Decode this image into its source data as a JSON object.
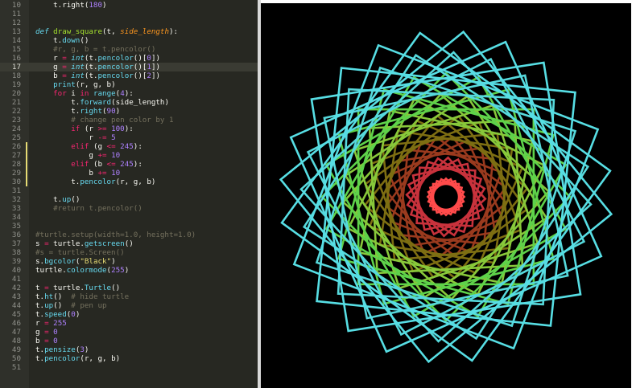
{
  "editor": {
    "lines": [
      {
        "n": "10",
        "t": [
          {
            "c": "    t.right(",
            "s": ""
          },
          {
            "c": "180",
            "s": "num"
          },
          {
            "c": ")",
            "s": ""
          }
        ]
      },
      {
        "n": "11",
        "t": []
      },
      {
        "n": "12",
        "t": []
      },
      {
        "n": "13",
        "t": [
          {
            "c": "def ",
            "s": "it"
          },
          {
            "c": "draw_square",
            "s": "fn"
          },
          {
            "c": "(t, ",
            "s": ""
          },
          {
            "c": "side_length",
            "s": "par"
          },
          {
            "c": "):",
            "s": ""
          }
        ]
      },
      {
        "n": "14",
        "t": [
          {
            "c": "    t.",
            "s": ""
          },
          {
            "c": "down",
            "s": "bi"
          },
          {
            "c": "()",
            "s": ""
          }
        ]
      },
      {
        "n": "15",
        "t": [
          {
            "c": "    #r, g, b = t.pencolor()",
            "s": "cm"
          }
        ]
      },
      {
        "n": "16",
        "t": [
          {
            "c": "    r ",
            "s": ""
          },
          {
            "c": "=",
            "s": "kw"
          },
          {
            "c": " ",
            "s": ""
          },
          {
            "c": "int",
            "s": "it"
          },
          {
            "c": "(t.",
            "s": ""
          },
          {
            "c": "pencolor",
            "s": "bi"
          },
          {
            "c": "()[",
            "s": ""
          },
          {
            "c": "0",
            "s": "num"
          },
          {
            "c": "])",
            "s": ""
          }
        ]
      },
      {
        "n": "17",
        "t": [
          {
            "c": "    g ",
            "s": ""
          },
          {
            "c": "=",
            "s": "kw"
          },
          {
            "c": " ",
            "s": ""
          },
          {
            "c": "int",
            "s": "it"
          },
          {
            "c": "(t.",
            "s": ""
          },
          {
            "c": "pencolor",
            "s": "bi"
          },
          {
            "c": "()[",
            "s": ""
          },
          {
            "c": "1",
            "s": "num"
          },
          {
            "c": "])",
            "s": ""
          }
        ],
        "active": true
      },
      {
        "n": "18",
        "t": [
          {
            "c": "    b ",
            "s": ""
          },
          {
            "c": "=",
            "s": "kw"
          },
          {
            "c": " ",
            "s": ""
          },
          {
            "c": "int",
            "s": "it"
          },
          {
            "c": "(t.",
            "s": ""
          },
          {
            "c": "pencolor",
            "s": "bi"
          },
          {
            "c": "()[",
            "s": ""
          },
          {
            "c": "2",
            "s": "num"
          },
          {
            "c": "])",
            "s": ""
          }
        ]
      },
      {
        "n": "19",
        "t": [
          {
            "c": "    ",
            "s": ""
          },
          {
            "c": "print",
            "s": "bi"
          },
          {
            "c": "(r, g, b)",
            "s": ""
          }
        ]
      },
      {
        "n": "20",
        "t": [
          {
            "c": "    ",
            "s": ""
          },
          {
            "c": "for",
            "s": "kw"
          },
          {
            "c": " i ",
            "s": ""
          },
          {
            "c": "in",
            "s": "kw"
          },
          {
            "c": " ",
            "s": ""
          },
          {
            "c": "range",
            "s": "bi"
          },
          {
            "c": "(",
            "s": ""
          },
          {
            "c": "4",
            "s": "num"
          },
          {
            "c": "):",
            "s": ""
          }
        ]
      },
      {
        "n": "21",
        "t": [
          {
            "c": "        t.",
            "s": ""
          },
          {
            "c": "forward",
            "s": "bi"
          },
          {
            "c": "(side_length)",
            "s": ""
          }
        ]
      },
      {
        "n": "22",
        "t": [
          {
            "c": "        t.",
            "s": ""
          },
          {
            "c": "right",
            "s": "bi"
          },
          {
            "c": "(",
            "s": ""
          },
          {
            "c": "90",
            "s": "num"
          },
          {
            "c": ")",
            "s": ""
          }
        ]
      },
      {
        "n": "23",
        "t": [
          {
            "c": "        # change pen color by 1",
            "s": "cm"
          }
        ]
      },
      {
        "n": "24",
        "t": [
          {
            "c": "        ",
            "s": ""
          },
          {
            "c": "if",
            "s": "kw"
          },
          {
            "c": " (r ",
            "s": ""
          },
          {
            "c": ">=",
            "s": "kw"
          },
          {
            "c": " ",
            "s": ""
          },
          {
            "c": "100",
            "s": "num"
          },
          {
            "c": "):",
            "s": ""
          }
        ]
      },
      {
        "n": "25",
        "t": [
          {
            "c": "            r ",
            "s": ""
          },
          {
            "c": "-=",
            "s": "kw"
          },
          {
            "c": " ",
            "s": ""
          },
          {
            "c": "5",
            "s": "num"
          }
        ]
      },
      {
        "n": "26",
        "t": [
          {
            "c": "        ",
            "s": ""
          },
          {
            "c": "elif",
            "s": "kw"
          },
          {
            "c": " (g ",
            "s": ""
          },
          {
            "c": "<=",
            "s": "kw"
          },
          {
            "c": " ",
            "s": ""
          },
          {
            "c": "245",
            "s": "num"
          },
          {
            "c": "):",
            "s": ""
          }
        ],
        "mod": true
      },
      {
        "n": "27",
        "t": [
          {
            "c": "            g ",
            "s": ""
          },
          {
            "c": "+=",
            "s": "kw"
          },
          {
            "c": " ",
            "s": ""
          },
          {
            "c": "10",
            "s": "num"
          }
        ],
        "mod": true
      },
      {
        "n": "28",
        "t": [
          {
            "c": "        ",
            "s": ""
          },
          {
            "c": "elif",
            "s": "kw"
          },
          {
            "c": " (b ",
            "s": ""
          },
          {
            "c": "<=",
            "s": "kw"
          },
          {
            "c": " ",
            "s": ""
          },
          {
            "c": "245",
            "s": "num"
          },
          {
            "c": "):",
            "s": ""
          }
        ],
        "mod": true
      },
      {
        "n": "29",
        "t": [
          {
            "c": "            b ",
            "s": ""
          },
          {
            "c": "+=",
            "s": "kw"
          },
          {
            "c": " ",
            "s": ""
          },
          {
            "c": "10",
            "s": "num"
          }
        ],
        "mod": true
      },
      {
        "n": "30",
        "t": [
          {
            "c": "        t.",
            "s": ""
          },
          {
            "c": "pencolor",
            "s": "bi"
          },
          {
            "c": "(r, g, b)",
            "s": ""
          }
        ],
        "mod": true
      },
      {
        "n": "31",
        "t": []
      },
      {
        "n": "32",
        "t": [
          {
            "c": "    t.",
            "s": ""
          },
          {
            "c": "up",
            "s": "bi"
          },
          {
            "c": "()",
            "s": ""
          }
        ]
      },
      {
        "n": "33",
        "t": [
          {
            "c": "    #return t.pencolor()",
            "s": "cm"
          }
        ]
      },
      {
        "n": "34",
        "t": []
      },
      {
        "n": "35",
        "t": []
      },
      {
        "n": "36",
        "t": [
          {
            "c": "#turtle.setup(width=1.0, height=1.0)",
            "s": "cm"
          }
        ]
      },
      {
        "n": "37",
        "t": [
          {
            "c": "s ",
            "s": ""
          },
          {
            "c": "=",
            "s": "kw"
          },
          {
            "c": " turtle.",
            "s": ""
          },
          {
            "c": "getscreen",
            "s": "bi"
          },
          {
            "c": "()",
            "s": ""
          }
        ]
      },
      {
        "n": "38",
        "t": [
          {
            "c": "#s = turtle.Screen()",
            "s": "cm"
          }
        ]
      },
      {
        "n": "39",
        "t": [
          {
            "c": "s.",
            "s": ""
          },
          {
            "c": "bgcolor",
            "s": "bi"
          },
          {
            "c": "(",
            "s": ""
          },
          {
            "c": "\"Black\"",
            "s": "str"
          },
          {
            "c": ")",
            "s": ""
          }
        ]
      },
      {
        "n": "40",
        "t": [
          {
            "c": "turtle.",
            "s": ""
          },
          {
            "c": "colormode",
            "s": "bi"
          },
          {
            "c": "(",
            "s": ""
          },
          {
            "c": "255",
            "s": "num"
          },
          {
            "c": ")",
            "s": ""
          }
        ]
      },
      {
        "n": "41",
        "t": []
      },
      {
        "n": "42",
        "t": [
          {
            "c": "t ",
            "s": ""
          },
          {
            "c": "=",
            "s": "kw"
          },
          {
            "c": " turtle.",
            "s": ""
          },
          {
            "c": "Turtle",
            "s": "bi"
          },
          {
            "c": "()",
            "s": ""
          }
        ]
      },
      {
        "n": "43",
        "t": [
          {
            "c": "t.",
            "s": ""
          },
          {
            "c": "ht",
            "s": "bi"
          },
          {
            "c": "()  ",
            "s": ""
          },
          {
            "c": "# hide turtle",
            "s": "cm"
          }
        ]
      },
      {
        "n": "44",
        "t": [
          {
            "c": "t.",
            "s": ""
          },
          {
            "c": "up",
            "s": "bi"
          },
          {
            "c": "()  ",
            "s": ""
          },
          {
            "c": "# pen up",
            "s": "cm"
          }
        ]
      },
      {
        "n": "45",
        "t": [
          {
            "c": "t.",
            "s": ""
          },
          {
            "c": "speed",
            "s": "bi"
          },
          {
            "c": "(",
            "s": ""
          },
          {
            "c": "0",
            "s": "num"
          },
          {
            "c": ")",
            "s": ""
          }
        ]
      },
      {
        "n": "46",
        "t": [
          {
            "c": "r ",
            "s": ""
          },
          {
            "c": "=",
            "s": "kw"
          },
          {
            "c": " ",
            "s": ""
          },
          {
            "c": "255",
            "s": "num"
          }
        ]
      },
      {
        "n": "47",
        "t": [
          {
            "c": "g ",
            "s": ""
          },
          {
            "c": "=",
            "s": "kw"
          },
          {
            "c": " ",
            "s": ""
          },
          {
            "c": "0",
            "s": "num"
          }
        ]
      },
      {
        "n": "48",
        "t": [
          {
            "c": "b ",
            "s": ""
          },
          {
            "c": "=",
            "s": "kw"
          },
          {
            "c": " ",
            "s": ""
          },
          {
            "c": "0",
            "s": "num"
          }
        ]
      },
      {
        "n": "49",
        "t": [
          {
            "c": "t.",
            "s": ""
          },
          {
            "c": "pensize",
            "s": "bi"
          },
          {
            "c": "(",
            "s": ""
          },
          {
            "c": "3",
            "s": "num"
          },
          {
            "c": ")",
            "s": ""
          }
        ]
      },
      {
        "n": "50",
        "t": [
          {
            "c": "t.",
            "s": ""
          },
          {
            "c": "pencolor",
            "s": "bi"
          },
          {
            "c": "(r, g, b)",
            "s": ""
          }
        ]
      },
      {
        "n": "51",
        "t": []
      }
    ]
  },
  "drawing": {
    "background": "#000000",
    "shapes": "rotated squares drawn by turtle graphics",
    "rings": [
      {
        "color": "#ff4b4b",
        "count": 6
      },
      {
        "color": "#c8323c",
        "count": 6
      },
      {
        "color": "#9a3a1e",
        "count": 6
      },
      {
        "color": "#7d6e12",
        "count": 6
      },
      {
        "color": "#88c83a",
        "count": 6
      },
      {
        "color": "#5ed24a",
        "count": 6
      },
      {
        "color": "#56d9dc",
        "count": 6
      },
      {
        "color": "#57dee4",
        "count": 6
      }
    ]
  }
}
